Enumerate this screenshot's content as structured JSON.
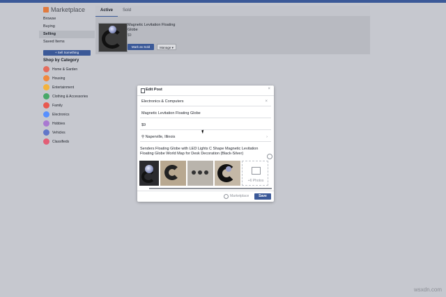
{
  "sidebar": {
    "title": "Marketplace",
    "nav": [
      "Browse",
      "Buying",
      "Selling",
      "Saved Items"
    ],
    "sell_button": "+ Sell Something",
    "section_title": "Shop by Category",
    "categories": [
      {
        "label": "Home & Garden",
        "color": "#e46c5c"
      },
      {
        "label": "Housing",
        "color": "#f08a3e"
      },
      {
        "label": "Entertainment",
        "color": "#f3b33d"
      },
      {
        "label": "Clothing & Accessories",
        "color": "#48a868"
      },
      {
        "label": "Family",
        "color": "#e8594f"
      },
      {
        "label": "Electronics",
        "color": "#5890ff"
      },
      {
        "label": "Hobbies",
        "color": "#a979d1"
      },
      {
        "label": "Vehicles",
        "color": "#6176c9"
      },
      {
        "label": "Classifieds",
        "color": "#e25e76"
      }
    ]
  },
  "tabs": [
    "Active",
    "Sold"
  ],
  "listing": {
    "title": "Magnetic Levitation Floating Globe",
    "price": "$9",
    "mark_sold": "Mark as Sold",
    "manage": "Manage ▾"
  },
  "modal": {
    "title": "Edit Post",
    "category": "Electronics & Computers",
    "item_title": "Magnetic Levitation Floating Globe",
    "price": "$9",
    "location": "Naperville, Illinois",
    "description": "Senders Floating Globe with LED Lights C Shape Magnetic Levitation Floating Globe World Map for Desk Decoration (Black-Silver)",
    "more_photos": "+6 Photos",
    "audience": "Marketplace",
    "save": "Save"
  },
  "watermark": "wsxdn.com",
  "accent_color": "#3b5998"
}
